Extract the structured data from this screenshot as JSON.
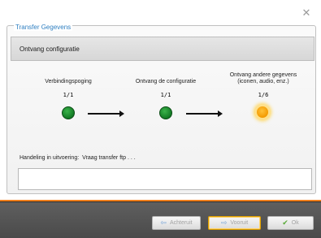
{
  "window": {
    "close_label": "✕"
  },
  "group": {
    "legend": "Transfer Gegevens"
  },
  "header": {
    "text": "Ontvang configuratie"
  },
  "steps": [
    {
      "label": "Verbindingspoging",
      "count": "1/1",
      "state": "done",
      "color": "#127a24"
    },
    {
      "label": "Ontvang de configuratie",
      "count": "1/1",
      "state": "done",
      "color": "#127a24"
    },
    {
      "label": "Ontvang andere gegevens\n(iconen, audio, enz.)",
      "label_line1": "Ontvang andere gegevens",
      "label_line2": "(iconen, audio, enz.)",
      "count": "1/6",
      "state": "in-progress",
      "color": "#f39a00"
    }
  ],
  "status": {
    "label": "Handeling in uitvoering:",
    "value": "Vraag transfer ftp . . ."
  },
  "log": {
    "text": ""
  },
  "buttons": {
    "back": {
      "label": "Achteruit",
      "icon": "arrow-left-icon"
    },
    "forward": {
      "label": "Vooruit",
      "icon": "arrow-right-icon"
    },
    "ok": {
      "label": "Ok",
      "icon": "checkmark-icon"
    }
  },
  "colors": {
    "accent": "#f07e1b",
    "legend": "#2f7fc1"
  }
}
